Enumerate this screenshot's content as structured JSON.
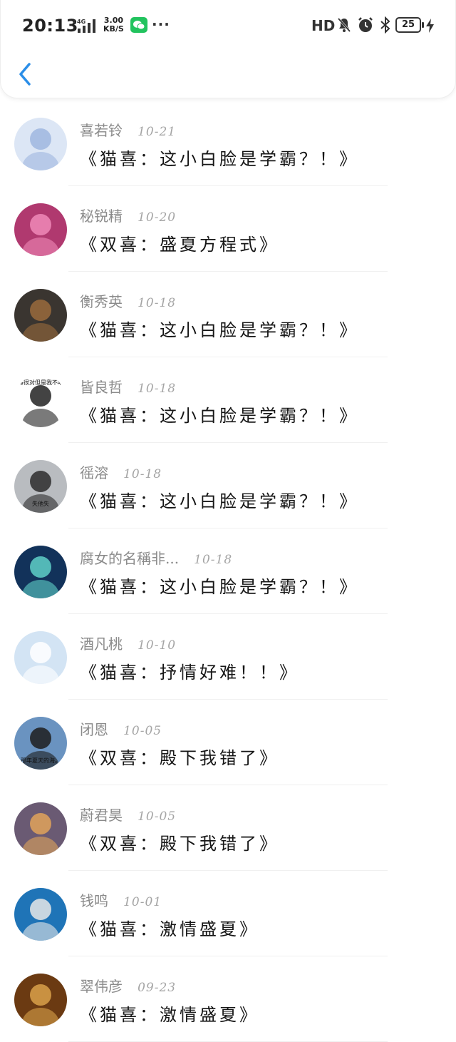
{
  "status_bar": {
    "time": "20:13",
    "network": "4G",
    "speed_value": "3.00",
    "speed_unit": "KB/S",
    "more": "···",
    "hd": "HD",
    "battery": "25"
  },
  "header": {
    "back_icon": "chevron-left-icon",
    "accent_color": "#2b8ee8"
  },
  "messages": [
    {
      "name": "喜若铃",
      "date": "10-21",
      "book": "《猫喜：这小白脸是学霸？！》",
      "avatar_bg": "#dce6f5",
      "avatar_fg": "#9fb6df",
      "avatar_icon": "anime-girl-avatar"
    },
    {
      "name": "秘锐精",
      "date": "10-20",
      "book": "《双喜：盛夏方程式》",
      "avatar_bg": "#b0396f",
      "avatar_fg": "#f08ab8",
      "avatar_icon": "girl-photo-avatar"
    },
    {
      "name": "衡秀英",
      "date": "10-18",
      "book": "《猫喜：这小白脸是学霸？！》",
      "avatar_bg": "#3a3530",
      "avatar_fg": "#9a6a3c",
      "avatar_icon": "girl-with-bear-avatar"
    },
    {
      "name": "皆良哲",
      "date": "10-18",
      "book": "《猫喜：这小白脸是学霸？！》",
      "avatar_bg": "#ffffff",
      "avatar_fg": "#222222",
      "avatar_icon": "meme-avatar",
      "avatar_caption": "你说得很对但是我不听你的"
    },
    {
      "name": "徭溶",
      "date": "10-18",
      "book": "《猫喜：这小白脸是学霸？！》",
      "avatar_bg": "#b9bcc0",
      "avatar_fg": "#2d2d2d",
      "avatar_icon": "grey-portrait-avatar",
      "avatar_caption": "失他失"
    },
    {
      "name": "腐女的名稱非...",
      "date": "10-18",
      "book": "《猫喜：这小白脸是学霸？！》",
      "avatar_bg": "#12325a",
      "avatar_fg": "#5fd0c8",
      "avatar_icon": "space-art-avatar"
    },
    {
      "name": "酒凡桃",
      "date": "10-10",
      "book": "《猫喜：抒情好难！！》",
      "avatar_bg": "#d3e4f4",
      "avatar_fg": "#ffffff",
      "avatar_icon": "qzone-star-avatar"
    },
    {
      "name": "闭恩",
      "date": "10-05",
      "book": "《双喜：殿下我错了》",
      "avatar_bg": "#6a93c0",
      "avatar_fg": "#1d1d1d",
      "avatar_icon": "summer-sea-avatar",
      "avatar_caption": "那年夏天的海。"
    },
    {
      "name": "蔚君昊",
      "date": "10-05",
      "book": "《双喜：殿下我错了》",
      "avatar_bg": "#6a5a73",
      "avatar_fg": "#e0a35a",
      "avatar_icon": "heart-leaf-avatar"
    },
    {
      "name": "钱鸣",
      "date": "10-01",
      "book": "《猫喜：激情盛夏》",
      "avatar_bg": "#1f74b7",
      "avatar_fg": "#e8e8e8",
      "avatar_icon": "masked-boy-avatar"
    },
    {
      "name": "翠伟彦",
      "date": "09-23",
      "book": "《猫喜：激情盛夏》",
      "avatar_bg": "#6b3a12",
      "avatar_fg": "#d9a14a",
      "avatar_icon": "warrior-avatar"
    }
  ]
}
